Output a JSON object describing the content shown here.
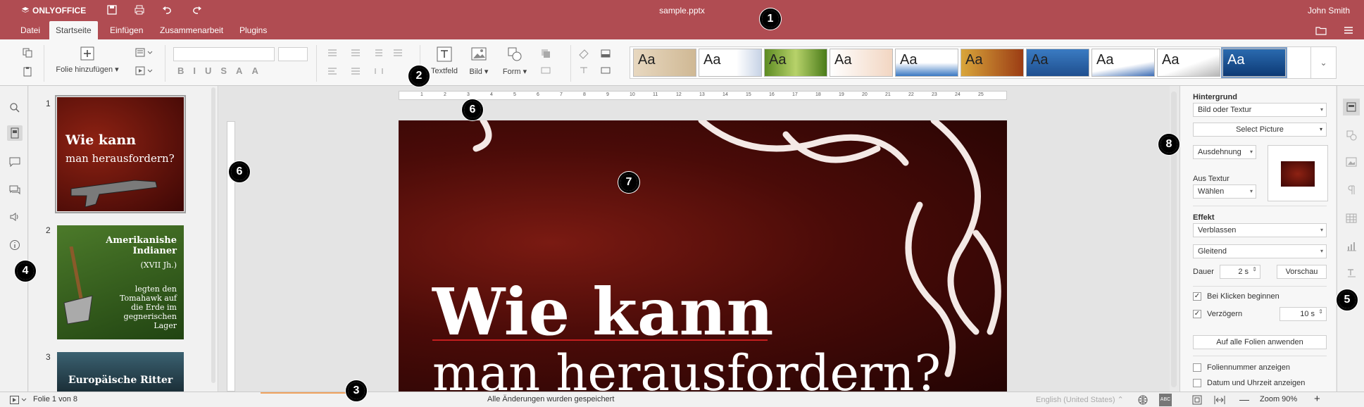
{
  "titlebar": {
    "logo": "ONLYOFFICE",
    "title": "sample.pptx",
    "user": "John Smith"
  },
  "tabs": [
    "Datei",
    "Startseite",
    "Einfügen",
    "Zusammenarbeit",
    "Plugins"
  ],
  "ribbon": {
    "add_slide": "Folie hinzufügen",
    "textfield": "Textfeld",
    "image": "Bild",
    "shape": "Form"
  },
  "themes": [
    "Aa",
    "Aa",
    "Aa",
    "Aa",
    "Aa",
    "Aa",
    "Aa",
    "Aa",
    "Aa",
    "Aa"
  ],
  "slides": [
    {
      "num": "1",
      "title": "Wie kann",
      "subtitle": "man herausfordern?"
    },
    {
      "num": "2",
      "title": "Amerikanishe Indianer",
      "subtitle": "(XVII Jh.)",
      "body": "legten den Tomahawk auf die Erde im gegnerischen Lager"
    },
    {
      "num": "3",
      "title": "Europäische Ritter"
    }
  ],
  "slide": {
    "title": "Wie kann",
    "subtitle": "man herausfordern?"
  },
  "ruler": [
    "1",
    "2",
    "3",
    "4",
    "5",
    "6",
    "7",
    "8",
    "9",
    "10",
    "11",
    "12",
    "13",
    "14",
    "15",
    "16",
    "17",
    "18",
    "19",
    "20",
    "21",
    "22",
    "23",
    "24",
    "25"
  ],
  "rightpanel": {
    "background_label": "Hintergrund",
    "background_value": "Bild oder Textur",
    "select_picture": "Select Picture",
    "stretch": "Ausdehnung",
    "from_texture": "Aus Textur",
    "choose": "Wählen",
    "effect_label": "Effekt",
    "effect_value": "Verblassen",
    "effect_type": "Gleitend",
    "duration_label": "Dauer",
    "duration_value": "2 s",
    "preview": "Vorschau",
    "start_on_click": "Bei Klicken beginnen",
    "delay": "Verzögern",
    "delay_value": "10 s",
    "apply_all": "Auf alle Folien anwenden",
    "show_slide_number": "Foliennummer anzeigen",
    "show_date": "Datum und Uhrzeit anzeigen"
  },
  "status": {
    "slide_of": "Folie 1 von 8",
    "saved": "Alle Änderungen wurden gespeichert",
    "language": "English (United States)",
    "zoom": "Zoom 90%"
  },
  "callouts": [
    "1",
    "2",
    "3",
    "4",
    "5",
    "6",
    "6",
    "7",
    "8"
  ]
}
